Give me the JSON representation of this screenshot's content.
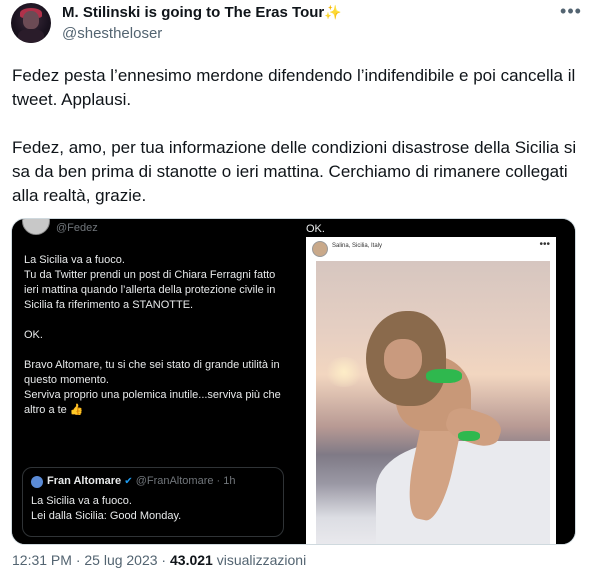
{
  "tweet": {
    "display_name": "M. Stilinski is going to The Eras Tour",
    "name_emoji": "✨",
    "handle": "@shestheloser",
    "more_icon": "•••",
    "paragraph1": "Fedez pesta l’ennesimo merdone difendendo l’indifendibile e poi cancella il tweet. Applausi.",
    "paragraph2": "Fedez, amo, per tua informazione delle condizioni disastrose della Sicilia si sa da ben prima di stanotte o ieri mattina. Cerchiamo di rimanere collegati alla realtà, grazie.",
    "meta_time": "12:31 PM · 25 lug 2023 · ",
    "views_count": "43.021",
    "views_label": " visualizzazioni"
  },
  "media": {
    "left": {
      "handle": "@Fedez",
      "lines": [
        "La Sicilia va a fuoco.\nTu da Twitter prendi un post di Chiara Ferragni fatto ieri mattina quando l’allerta della protezione civile in Sicilia fa riferimento a STANOTTE.",
        "OK.",
        "Bravo Altomare, tu si che sei stato di grande utilità in questo momento.\nServiva proprio una polemica inutile...serviva più che altro a te"
      ],
      "thumb_emoji": "👍",
      "quote": {
        "name": "Fran Altomare",
        "verified_icon": "✔",
        "handle": "@FranAltomare · 1h",
        "text": "La Sicilia va a fuoco.\nLei dalla Sicilia: Good Monday."
      }
    },
    "right": {
      "label": "OK.",
      "location": "Salina, Sicilia, Italy",
      "more_icon": "•••"
    }
  }
}
